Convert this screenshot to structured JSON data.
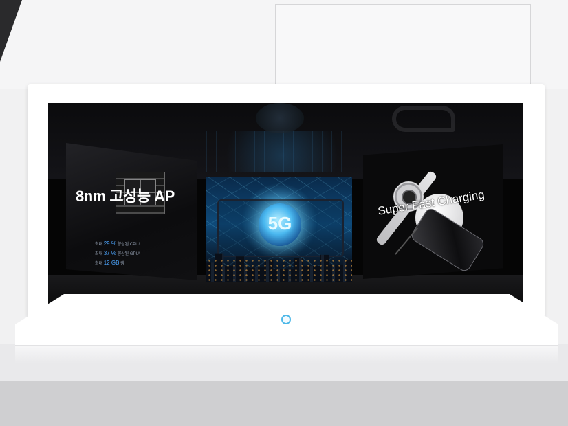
{
  "display": {
    "left_panel": {
      "title": "8nm 고성능 AP",
      "specs": [
        {
          "prefix": "최대",
          "value": "29 %",
          "suffix": "향상된 CPU¹"
        },
        {
          "prefix": "최대",
          "value": "37 %",
          "suffix": "향상된 GPU¹"
        },
        {
          "prefix": "최대",
          "value": "12 GB",
          "suffix": "램"
        }
      ]
    },
    "center_panel": {
      "badge": "5G"
    },
    "right_panel": {
      "title": "Super Fast Charging"
    }
  },
  "colors": {
    "frame": "#ffffff",
    "screen": "#050505",
    "accent_blue": "#4db8e8",
    "spec_highlight": "#4da6ff"
  },
  "icons": {
    "power_button": "power-button-ring"
  }
}
